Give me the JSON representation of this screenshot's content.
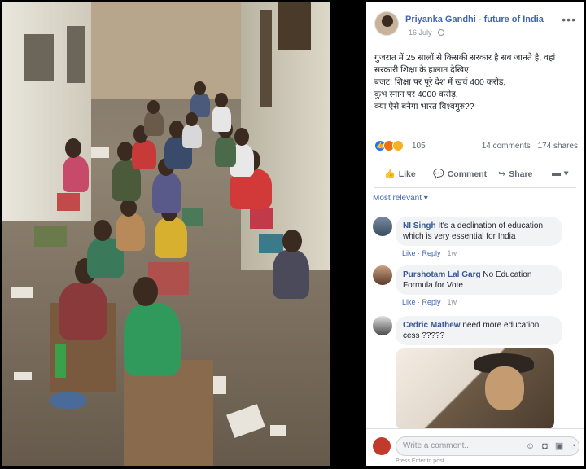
{
  "post": {
    "page_name": "Priyanka Gandhi - future of India",
    "date": "16 July",
    "more_icon": "more-horizontal-icon",
    "text_lines": [
      "गुजरात में 25 सालों से किसकी सरकार है सब जानते है, वहां",
      "सरकारी शिक्षा के हालात देखिए,",
      "बजट! शिक्षा पर पूरे देश में खर्च 400 करोड़,",
      "कुंभ स्नान पर 4000 करोड़,",
      "क्या ऐसे बनेगा भारत विश्वगुरु??"
    ],
    "reaction_count": "105",
    "comments_count": "14 comments",
    "shares_count": "174 shares",
    "actions": {
      "like": "Like",
      "comment": "Comment",
      "share": "Share"
    },
    "most_relevant": "Most relevant ▾",
    "colors": {
      "link": "#4267b2",
      "like_blue": "#1877f2",
      "angry": "#e9710f",
      "sad": "#f7b125"
    }
  },
  "comments": [
    {
      "name": "NI Singh",
      "text": "It's a declination of education which is very essential for India",
      "like": "Like",
      "reply": "Reply",
      "time": "1w"
    },
    {
      "name": "Purshotam Lal Garg",
      "text": "No Education Formula for Vote .",
      "like": "Like",
      "reply": "Reply",
      "time": "1w"
    },
    {
      "name": "Cedric Mathew",
      "text": "need more education cess ?????"
    }
  ],
  "write_comment": {
    "placeholder": "Write a comment...",
    "hint": "Press Enter to post.",
    "icons": [
      "emoji-icon",
      "camera-icon",
      "gif-icon",
      "sticker-icon"
    ]
  }
}
